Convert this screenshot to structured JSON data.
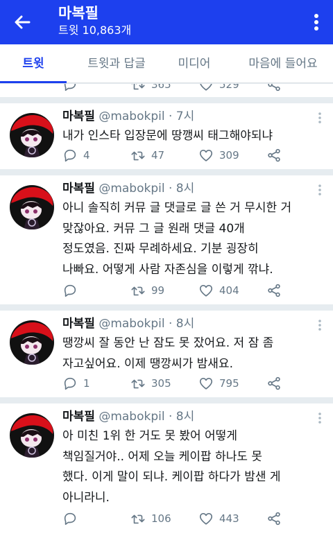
{
  "header": {
    "name": "마복필",
    "tweet_count": "트윗 10,863개"
  },
  "tabs": [
    {
      "label": "트윗"
    },
    {
      "label": "트윗과 답글"
    },
    {
      "label": "미디어"
    },
    {
      "label": "마음에 들어요"
    }
  ],
  "partial_tweet": {
    "retweets": "365",
    "likes": "529"
  },
  "tweets": [
    {
      "name": "마복필",
      "meta": "@mabokpil · 7시",
      "text": "내가 인스타 입장문에 땅깽씨 태그해야되냐",
      "replies": "4",
      "retweets": "47",
      "likes": "309"
    },
    {
      "name": "마복필",
      "meta": "@mabokpil · 8시",
      "text": "아니 솔직히 커뮤 글 댓글로 글 쓴 거 무시한 거\n맞잖아요. 커뮤 그 글 원래 댓글 40개\n정도였음. 진짜 무례하세요. 기분 굉장히\n나빠요. 어떻게 사람 자존심을 이렇게 깎냐.",
      "replies": "",
      "retweets": "99",
      "likes": "404"
    },
    {
      "name": "마복필",
      "meta": "@mabokpil · 8시",
      "text": "땡깡씨 잘 동안 난 잠도 못 잤어요. 저 잠 좀\n자고싶어요. 이제 땡깡씨가 밤새요.",
      "replies": "1",
      "retweets": "305",
      "likes": "795"
    },
    {
      "name": "마복필",
      "meta": "@mabokpil · 8시",
      "text": "아 미친 1위 한 거도 못 봤어 어떻게\n책임질거야.. 어제 오늘 케이팝 하나도 못\n했다. 이게 말이 되냐. 케이팝 하다가 밤샌 게\n아니라니.",
      "replies": "",
      "retweets": "106",
      "likes": "443"
    }
  ],
  "icons": {
    "back": "arrow-left-icon",
    "more": "more-vertical-icon",
    "reply": "reply-icon",
    "retweet": "retweet-icon",
    "like": "heart-icon",
    "share": "share-icon",
    "caret": "chevron-down-icon"
  },
  "colors": {
    "brand_blue": "#1d40ee",
    "text_primary": "#14171a",
    "text_secondary": "#657786",
    "divider": "#e6ecf0"
  }
}
